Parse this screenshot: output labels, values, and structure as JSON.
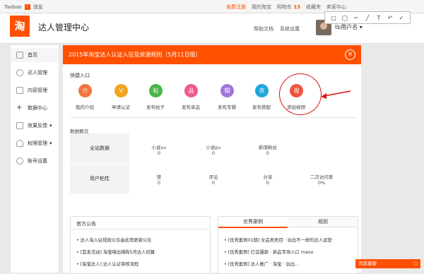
{
  "topbar": {
    "left_items": [
      "Taobao",
      "Hi!",
      "消息"
    ],
    "right_items": [
      "我的淘宝",
      "收藏夹",
      "购物车",
      "卖家中心",
      "联系客服",
      "网站导航"
    ],
    "cart_count": "13",
    "highlight": "免费注册"
  },
  "header": {
    "logo_char": "淘",
    "app_title": "达人管理中心",
    "help": "帮助文档",
    "settings": "系统设置",
    "username": "tb用户名"
  },
  "sidebar": {
    "items": [
      {
        "label": "首页"
      },
      {
        "label": "达人管理"
      },
      {
        "label": "内容管理"
      },
      {
        "label": "数据中心"
      },
      {
        "label": "效果反馈"
      },
      {
        "label": "权限管理"
      },
      {
        "label": "账号设置"
      }
    ]
  },
  "banner": {
    "text": "2015年淘宝达人认证入驻及资源规则（5月11日版）",
    "close_glyph": "×"
  },
  "quick": {
    "title": "快捷入口",
    "items": [
      {
        "label": "我的介绍",
        "color": "#f2753f",
        "glyph": "介"
      },
      {
        "label": "申请认证",
        "color": "#f3a31c",
        "glyph": "V"
      },
      {
        "label": "发布帖子",
        "color": "#49b649",
        "glyph": "帖"
      },
      {
        "label": "发布单品",
        "color": "#ee5a8f",
        "glyph": "品"
      },
      {
        "label": "发布专辑",
        "color": "#a275d8",
        "glyph": "辑"
      },
      {
        "label": "发布搭配",
        "color": "#21a6db",
        "glyph": "衣"
      },
      {
        "label": "添加视频",
        "color": "#f0533d",
        "glyph": "视"
      }
    ]
  },
  "data": {
    "title": "数据概况",
    "row1_head": "全站数据",
    "row2_head": "用户粘性",
    "row1": [
      {
        "label": "小说uv",
        "value": "0"
      },
      {
        "label": "小说pv",
        "value": "0"
      },
      {
        "label": "新增粉丝",
        "value": "0"
      }
    ],
    "row2": [
      {
        "label": "赞",
        "value": "0"
      },
      {
        "label": "评论",
        "value": "0"
      },
      {
        "label": "分享",
        "value": "0"
      },
      {
        "label": "二次访问率",
        "value": "0%"
      }
    ]
  },
  "announcements": {
    "title": "官方公告",
    "items": [
      "达人淘入驻规则公告由此而更新公告",
      "[首发活动] 淘宝嗨出嗨购5月达人招募",
      "[淘宝达人] 达人认证审核流程"
    ]
  },
  "cases": {
    "tabs": [
      "优秀案例",
      "规则"
    ],
    "items": [
      "[优秀案例01期] 全品类类目 · 玩出不一样的达人运营·",
      "[优秀案例] 打造爆款 · 新品专场入口 maoo",
      "[优秀案例] 达人推广 · 淘宝 · 玩出..."
    ]
  },
  "widget": {
    "label": "消息客服"
  },
  "tools": [
    "▢",
    "◯",
    "⌐",
    "╱",
    "T",
    "↶",
    "✓"
  ]
}
